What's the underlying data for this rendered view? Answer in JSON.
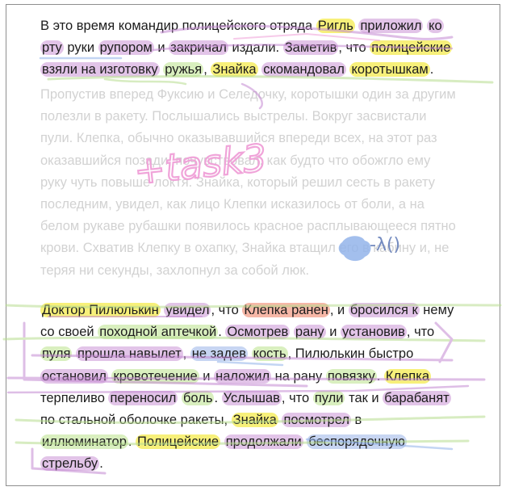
{
  "paragraph1": {
    "s01": "В это время командир полицейского отряда ",
    "s02": "Ригль",
    "s03": " ",
    "s04": "приложил",
    "s05": " ",
    "s06": "ко рту",
    "s07": " руки ",
    "s08": "рупором",
    "s09": " и ",
    "s10": "закричал",
    "s11": " издали. ",
    "s12": "Заметив",
    "s13": ", что ",
    "s14": "полицейские",
    "s15": " ",
    "s16": "взяли на изготовку",
    "s17": " ",
    "s18": "ружья",
    "s19": ", ",
    "s20": "Знайка",
    "s21": " ",
    "s22": "скомандовал",
    "s23": " ",
    "s24": "коротышкам",
    "s25": "."
  },
  "faded_text": "Пропустив вперед Фуксию и Селедочку, коротышки один за другим полезли в ракету. Послышались выстрелы. Вокруг засвистали пули. Клепка, обычно оказывавшийся впереди всех, на этот раз оказавшийся позади, почувствовал, как будто что обожгло ему руку чуть повыше локтя. Знайка, который решил сесть в ракету последним, увидел, как лицо Клепки исказилось от боли, а на белом рукаве рубашки появилось красное расплывающееся пятно крови. Схватив Клепку в охапку, Знайка втащил его в кабину и, не теряя ни секунды, захлопнул за собой люк.",
  "paragraph3": {
    "t01": "Доктор Пилюлькин",
    "t02": " ",
    "t03": "увидел",
    "t04": ", что ",
    "t05": "Клепка ранен",
    "t06": ", и ",
    "t07": "бросился к",
    "t08": " нему со своей ",
    "t09": "походной аптечкой",
    "t10": ". ",
    "t11": "Осмотрев",
    "t12": " ",
    "t13": "рану",
    "t14": " и ",
    "t15": "установив",
    "t16": ", что ",
    "t17": "пуля",
    "t18": " ",
    "t19": "прошла навылет",
    "t20": ", ",
    "t21": "не задев",
    "t22": " ",
    "t23": "кость",
    "t24": ", Пилюлькин быстро ",
    "t25": "остановил",
    "t26": " ",
    "t27": "кровотечение",
    "t28": " и ",
    "t29": "наложил",
    "t30": " на рану ",
    "t31": "повязку",
    "t32": ". ",
    "t33": "Клепка",
    "t34": " терпеливо ",
    "t35": "переносил",
    "t36": " ",
    "t37": "боль",
    "t38": ". ",
    "t39": "Услышав",
    "t40": ", что ",
    "t41": "пули",
    "t42": " так и ",
    "t43": "барабанят",
    "t44": " по стальной оболочке ракеты, ",
    "t45": "Знайка",
    "t46": " ",
    "t47": "посмотрел",
    "t48": " в ",
    "t49": "иллюминатор",
    "t50": ". ",
    "t51": "Полицейские",
    "t52": " ",
    "t53": "продолжали",
    "t54": " ",
    "t55": "беспорядочную",
    "t56": " ",
    "t57": "стрельбу",
    "t58": "."
  },
  "handwritten_note": "+task3",
  "sticker_label": "-λ()",
  "colors": {
    "yellow": "#f7f07a",
    "purple": "#e2c4e8",
    "green": "#d9efbf",
    "blue": "#c7d5f2",
    "red": "#f6b7a7",
    "pen_pink": "#f0a0d8",
    "pen_purple": "#c489d2",
    "pen_green": "#b8dd90",
    "pen_blue": "#93b4ea"
  }
}
